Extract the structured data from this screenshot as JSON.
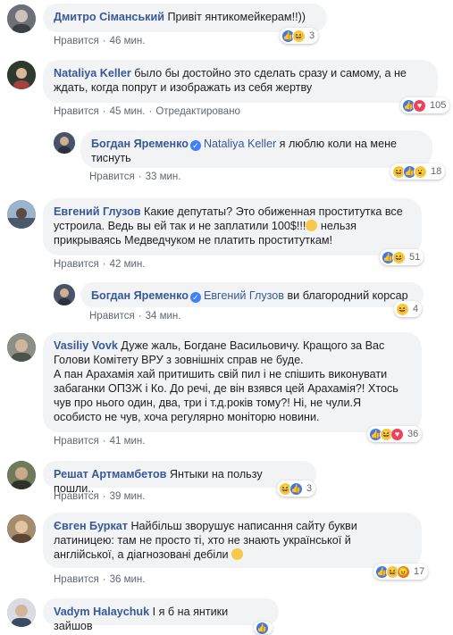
{
  "comments": [
    {
      "author": "Дмитро Сіманський",
      "text": " Привіт янтикомейкерам!!))",
      "like": "Нравится",
      "time": "46 мин.",
      "reactions": [
        "like",
        "haha"
      ],
      "count": "3"
    },
    {
      "author": "Nataliya Keller",
      "text": " было бы достойно это сделать сразу и самому, а не ждать, когда попрут и изображать из себя жертву",
      "like": "Нравится",
      "time": "45 мин.",
      "edited": "Отредактировано",
      "reactions": [
        "like",
        "love"
      ],
      "count": "105"
    },
    {
      "author": "Богдан Яременко",
      "mention": "Nataliya Keller",
      "text": " я люблю коли на мене тиснуть",
      "like": "Нравится",
      "time": "33 мин.",
      "reactions": [
        "haha",
        "like",
        "wow"
      ],
      "count": "18"
    },
    {
      "author": "Евгений Глузов",
      "text": " Какие депутаты? Это обиженная проститутка все устроила. Ведь вы ей так и не заплатили 100$!!!",
      "emoji": "grinning-emoji",
      "text2": " нельзя прикрываясь Медведчуком не платить проституткам!",
      "like": "Нравится",
      "time": "42 мин.",
      "reactions": [
        "like",
        "haha"
      ],
      "count": "51"
    },
    {
      "author": "Богдан Яременко",
      "mention": "Евгений Глузов",
      "text": " ви благородний корсар",
      "like": "Нравится",
      "time": "34 мин.",
      "reactions": [
        "haha"
      ],
      "count": "4"
    },
    {
      "author": "Vasiliy Vovk",
      "text": " Дуже жаль, Богдане Васильовичу. Кращого за Вас Голови Комітету ВРУ з зовнішніх справ не буде.",
      "text2": "А пан Арахамія хай притишить свій пил і не спішить виконувати забаганки ОПЗЖ і Ко. До речі, де він взявся цей Арахамія?! Хтось чув про нього один, два, три і т.д.років тому?! Ні, не чули.Я особисто не чув, хоча регулярно моніторю новини.",
      "like": "Нравится",
      "time": "41 мин.",
      "reactions": [
        "like",
        "haha",
        "love"
      ],
      "count": "36"
    },
    {
      "author": "Решат Артмамбетов",
      "text": " Янтыки на пользу пошли..",
      "like": "Нравится",
      "time": "39 мин.",
      "reactions": [
        "haha",
        "like"
      ],
      "count": "3"
    },
    {
      "author": "Євген Буркат",
      "text": " Найбільш зворушує написання сайту букви латиницею: там не просто ті, хто не знають української й англійської, а діагнозовані дебіли",
      "emoji": "pensive-emoji",
      "like": "Нравится",
      "time": "36 мин.",
      "reactions": [
        "like",
        "haha",
        "angry"
      ],
      "count": "17"
    },
    {
      "author": "Vadym Halaychuk",
      "text": " І я б на янтики зайшов",
      "like": "Нравится",
      "time": "35 мин.",
      "reactions": [
        "like"
      ],
      "count": ""
    }
  ],
  "colors": {
    "link": "#385898",
    "bubble": "#f2f3f5",
    "meta": "#606770"
  }
}
